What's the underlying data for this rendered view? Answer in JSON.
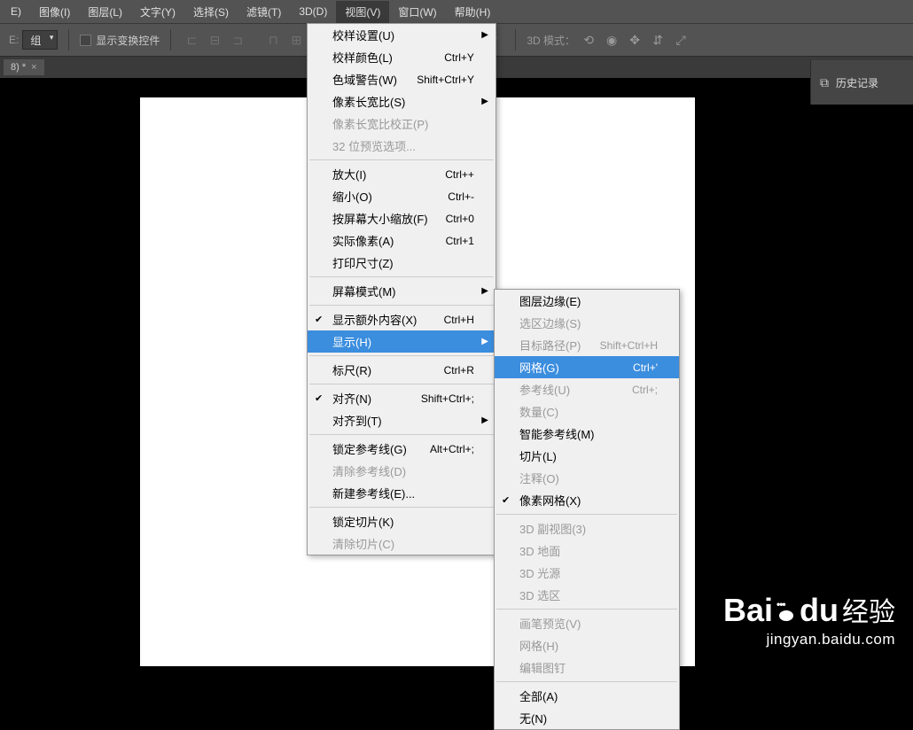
{
  "menubar": {
    "items": [
      {
        "label": "E)"
      },
      {
        "label": "图像(I)"
      },
      {
        "label": "图层(L)"
      },
      {
        "label": "文字(Y)"
      },
      {
        "label": "选择(S)"
      },
      {
        "label": "滤镜(T)"
      },
      {
        "label": "3D(D)"
      },
      {
        "label": "视图(V)",
        "active": true
      },
      {
        "label": "窗口(W)"
      },
      {
        "label": "帮助(H)"
      }
    ]
  },
  "toolbar": {
    "group_dropdown": "组",
    "show_transform": "显示变换控件",
    "mode_3d": "3D 模式："
  },
  "tab": {
    "name": "8) *",
    "close": "×"
  },
  "panel": {
    "history": "历史记录"
  },
  "view_menu": {
    "items": [
      {
        "type": "item",
        "label": "校样设置(U)",
        "arrow": true
      },
      {
        "type": "item",
        "label": "校样颜色(L)",
        "shortcut": "Ctrl+Y"
      },
      {
        "type": "item",
        "label": "色域警告(W)",
        "shortcut": "Shift+Ctrl+Y"
      },
      {
        "type": "item",
        "label": "像素长宽比(S)",
        "arrow": true
      },
      {
        "type": "item",
        "label": "像素长宽比校正(P)",
        "disabled": true
      },
      {
        "type": "item",
        "label": "32 位预览选项...",
        "disabled": true
      },
      {
        "type": "sep"
      },
      {
        "type": "item",
        "label": "放大(I)",
        "shortcut": "Ctrl++"
      },
      {
        "type": "item",
        "label": "缩小(O)",
        "shortcut": "Ctrl+-"
      },
      {
        "type": "item",
        "label": "按屏幕大小缩放(F)",
        "shortcut": "Ctrl+0"
      },
      {
        "type": "item",
        "label": "实际像素(A)",
        "shortcut": "Ctrl+1"
      },
      {
        "type": "item",
        "label": "打印尺寸(Z)"
      },
      {
        "type": "sep"
      },
      {
        "type": "item",
        "label": "屏幕模式(M)",
        "arrow": true
      },
      {
        "type": "sep"
      },
      {
        "type": "item",
        "label": "显示额外内容(X)",
        "shortcut": "Ctrl+H",
        "checked": true
      },
      {
        "type": "item",
        "label": "显示(H)",
        "arrow": true,
        "highlighted": true
      },
      {
        "type": "sep"
      },
      {
        "type": "item",
        "label": "标尺(R)",
        "shortcut": "Ctrl+R"
      },
      {
        "type": "sep"
      },
      {
        "type": "item",
        "label": "对齐(N)",
        "shortcut": "Shift+Ctrl+;",
        "checked": true
      },
      {
        "type": "item",
        "label": "对齐到(T)",
        "arrow": true
      },
      {
        "type": "sep"
      },
      {
        "type": "item",
        "label": "锁定参考线(G)",
        "shortcut": "Alt+Ctrl+;"
      },
      {
        "type": "item",
        "label": "清除参考线(D)",
        "disabled": true
      },
      {
        "type": "item",
        "label": "新建参考线(E)..."
      },
      {
        "type": "sep"
      },
      {
        "type": "item",
        "label": "锁定切片(K)"
      },
      {
        "type": "item",
        "label": "清除切片(C)",
        "disabled": true
      }
    ]
  },
  "show_submenu": {
    "items": [
      {
        "type": "item",
        "label": "图层边缘(E)"
      },
      {
        "type": "item",
        "label": "选区边缘(S)",
        "disabled": true
      },
      {
        "type": "item",
        "label": "目标路径(P)",
        "shortcut": "Shift+Ctrl+H",
        "disabled": true
      },
      {
        "type": "item",
        "label": "网格(G)",
        "shortcut": "Ctrl+'",
        "highlighted": true
      },
      {
        "type": "item",
        "label": "参考线(U)",
        "shortcut": "Ctrl+;",
        "disabled": true
      },
      {
        "type": "item",
        "label": "数量(C)",
        "disabled": true
      },
      {
        "type": "item",
        "label": "智能参考线(M)"
      },
      {
        "type": "item",
        "label": "切片(L)"
      },
      {
        "type": "item",
        "label": "注释(O)",
        "disabled": true
      },
      {
        "type": "item",
        "label": "像素网格(X)",
        "checked": true
      },
      {
        "type": "sep"
      },
      {
        "type": "item",
        "label": "3D 副视图(3)",
        "disabled": true
      },
      {
        "type": "item",
        "label": "3D 地面",
        "disabled": true
      },
      {
        "type": "item",
        "label": "3D 光源",
        "disabled": true
      },
      {
        "type": "item",
        "label": "3D 选区",
        "disabled": true
      },
      {
        "type": "sep"
      },
      {
        "type": "item",
        "label": "画笔预览(V)",
        "disabled": true
      },
      {
        "type": "item",
        "label": "网格(H)",
        "disabled": true
      },
      {
        "type": "item",
        "label": "编辑图钉",
        "disabled": true
      },
      {
        "type": "sep"
      },
      {
        "type": "item",
        "label": "全部(A)"
      },
      {
        "type": "item",
        "label": "无(N)"
      }
    ]
  },
  "watermark": {
    "brand": "Bai",
    "brand2": "du",
    "cn": "经验",
    "url": "jingyan.baidu.com"
  }
}
